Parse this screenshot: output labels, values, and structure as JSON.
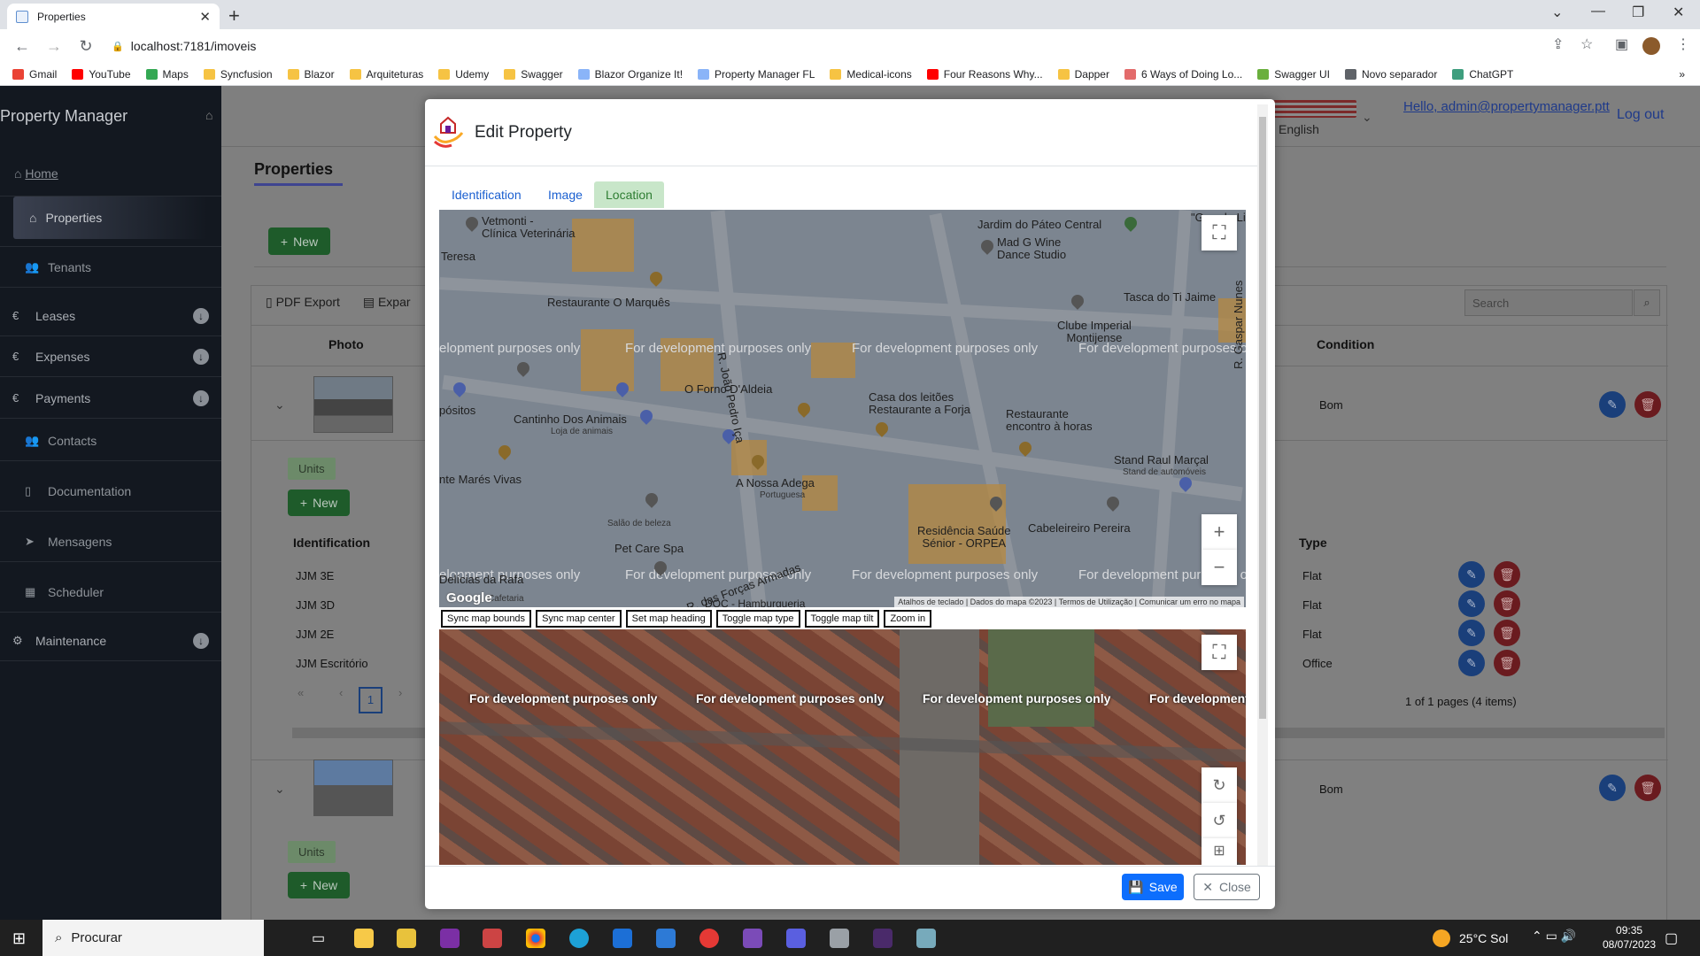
{
  "browser": {
    "tab_title": "Properties",
    "url": "localhost:7181/imoveis",
    "bookmarks": [
      {
        "label": "Gmail",
        "color": "#ea4335"
      },
      {
        "label": "YouTube",
        "color": "#ff0000"
      },
      {
        "label": "Maps",
        "color": "#34a853"
      },
      {
        "label": "Syncfusion",
        "color": "#f6c343"
      },
      {
        "label": "Blazor",
        "color": "#f6c343"
      },
      {
        "label": "Arquiteturas",
        "color": "#f6c343"
      },
      {
        "label": "Udemy",
        "color": "#f6c343"
      },
      {
        "label": "Swagger",
        "color": "#f6c343"
      },
      {
        "label": "Blazor Organize It!",
        "color": "#8ab4f8"
      },
      {
        "label": "Property Manager FL",
        "color": "#8ab4f8"
      },
      {
        "label": "Medical-icons",
        "color": "#f6c343"
      },
      {
        "label": "Four Reasons Why...",
        "color": "#ff0000"
      },
      {
        "label": "Dapper",
        "color": "#f6c343"
      },
      {
        "label": "6 Ways of Doing Lo...",
        "color": "#e36b6b"
      },
      {
        "label": "Swagger UI",
        "color": "#6aaf3d"
      },
      {
        "label": "Novo separador",
        "color": "#5f6368"
      },
      {
        "label": "ChatGPT",
        "color": "#3e9e7e"
      }
    ],
    "more_bookmarks": "»"
  },
  "app": {
    "brand": "Property Manager",
    "home_link": "Home",
    "language": "English",
    "user_greeting": "Hello, admin@propertymanager.ptt",
    "logout": "Log out",
    "sidebar": {
      "properties": "Properties",
      "tenants": "Tenants",
      "leases": "Leases",
      "expenses": "Expenses",
      "payments": "Payments",
      "contacts": "Contacts",
      "documentation": "Documentation",
      "mensagens": "Mensagens",
      "scheduler": "Scheduler",
      "maintenance": "Maintenance"
    },
    "page_title": "Properties",
    "new_label": "New",
    "pdf_export": "PDF Export",
    "excel_export": "Expar",
    "search_placeholder": "Search",
    "columns": {
      "photo": "Photo",
      "condition": "Condition"
    },
    "rows": [
      {
        "condition": "Bom"
      },
      {
        "condition": "Bom"
      }
    ],
    "units_tab": "Units",
    "units_columns": {
      "identification": "Identification",
      "type": "Type"
    },
    "units": [
      {
        "id": "JJM 3E",
        "type": "Flat"
      },
      {
        "id": "JJM 3D",
        "type": "Flat"
      },
      {
        "id": "JJM 2E",
        "type": "Flat"
      },
      {
        "id": "JJM Escritório",
        "type": "Office"
      }
    ],
    "pager_current": "1",
    "pager_summary": "1 of 1 pages (4 items)"
  },
  "modal": {
    "title": "Edit Property",
    "tabs": [
      "Identification",
      "Image",
      "Location"
    ],
    "active_tab": "Location",
    "map": {
      "dev_watermark": "For development purposes only",
      "dev_watermark_short": "elopment purposes only",
      "dev_watermark_cut": "For development",
      "pois": {
        "clinica": "Vetmonti -\nClínica Veterinária",
        "teresa": "Teresa",
        "restaurante_marques": "Restaurante O Marquês",
        "jardim": "Jardim do Páteo Central",
        "mad_g": "Mad G Wine\nDance Studio",
        "grande_lisboa": "\"Grande Lisboa",
        "tasca": "Tasca do Ti Jaime",
        "clube": "Clube Imperial\nMontijense",
        "forno": "O Forno D'Aldeia",
        "joao_pedro": "R. João Pedro Iça",
        "cantinho": "Cantinho Dos Animais",
        "loja_animais": "Loja de animais",
        "casa_leitoes": "Casa dos leitões\nRestaurante a Forja",
        "restaurante_encontro": "Restaurante\nencontro à horas",
        "stand": "Stand Raul Marçal",
        "stand_sub": "Stand de automóveis",
        "gaspar": "R. Gaspar Nunes",
        "posito": "pósitos",
        "mares": "nte Marés Vivas",
        "adega": "A Nossa Adega",
        "adega_sub": "Portuguesa",
        "salao": "Salão de beleza",
        "residencia": "Residência Saúde\nSénior - ORPEA",
        "cabeleireiro": "Cabeleireiro Pereira",
        "pet_care": "Pet Care Spa",
        "delicias": "Delícias da Rafa",
        "cafetaria": "Cafetaria",
        "dos_forcados": "R. das Forças Armadas",
        "hamburgueria": "DOC - Hamburgueria"
      },
      "attribution": [
        "Atalhos de teclado",
        "Dados do mapa ©2023",
        "Termos de Utilização",
        "Comunicar um erro no mapa"
      ],
      "google_logo": "Google",
      "controls": [
        "Sync map bounds",
        "Sync map center",
        "Set map heading",
        "Toggle map type",
        "Toggle map tilt",
        "Zoom in"
      ]
    },
    "save": "Save",
    "close": "Close"
  },
  "taskbar": {
    "search": "Procurar",
    "weather": "25°C  Sol",
    "time": "09:35",
    "date": "08/07/2023"
  }
}
